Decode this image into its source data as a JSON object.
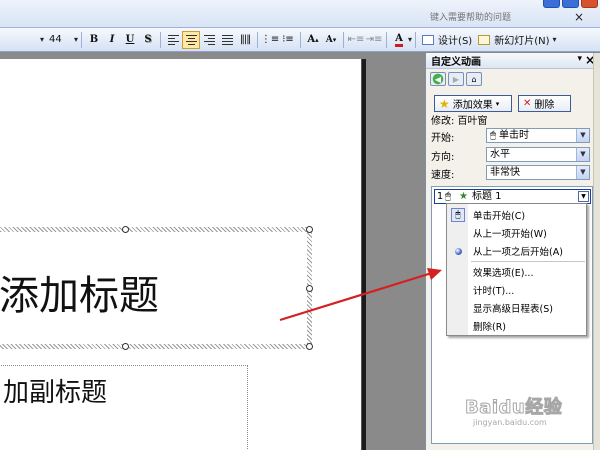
{
  "help_box": {
    "placeholder": "键入需要帮助的问题"
  },
  "toolbar": {
    "font_size": "44",
    "bold": "B",
    "italic": "I",
    "underline": "U",
    "shadow": "S",
    "grow_font": "A",
    "shrink_font": "A",
    "font_color": "A",
    "design_label": "设计(S)",
    "new_slide_label": "新幻灯片(N)"
  },
  "task_pane": {
    "title": "自定义动画",
    "add_effect_label": "添加效果",
    "remove_label": "删除",
    "modify_label": "修改: 百叶窗",
    "start_label": "开始:",
    "start_value": "单击时",
    "direction_label": "方向:",
    "direction_value": "水平",
    "speed_label": "速度:",
    "speed_value": "非常快",
    "animation_item": {
      "number": "1",
      "label": "标题 1"
    }
  },
  "context_menu": {
    "items": [
      "单击开始(C)",
      "从上一项开始(W)",
      "从上一项之后开始(A)",
      "效果选项(E)...",
      "计时(T)...",
      "显示高级日程表(S)",
      "删除(R)"
    ]
  },
  "slide": {
    "title_placeholder": "添加标题",
    "subtitle_placeholder": "加副标题"
  },
  "watermark": {
    "brand": "Baidu经验",
    "url": "jingyan.baidu.com"
  },
  "colors": {
    "arrow": "#d42020",
    "selection": "#1b3d9a"
  }
}
